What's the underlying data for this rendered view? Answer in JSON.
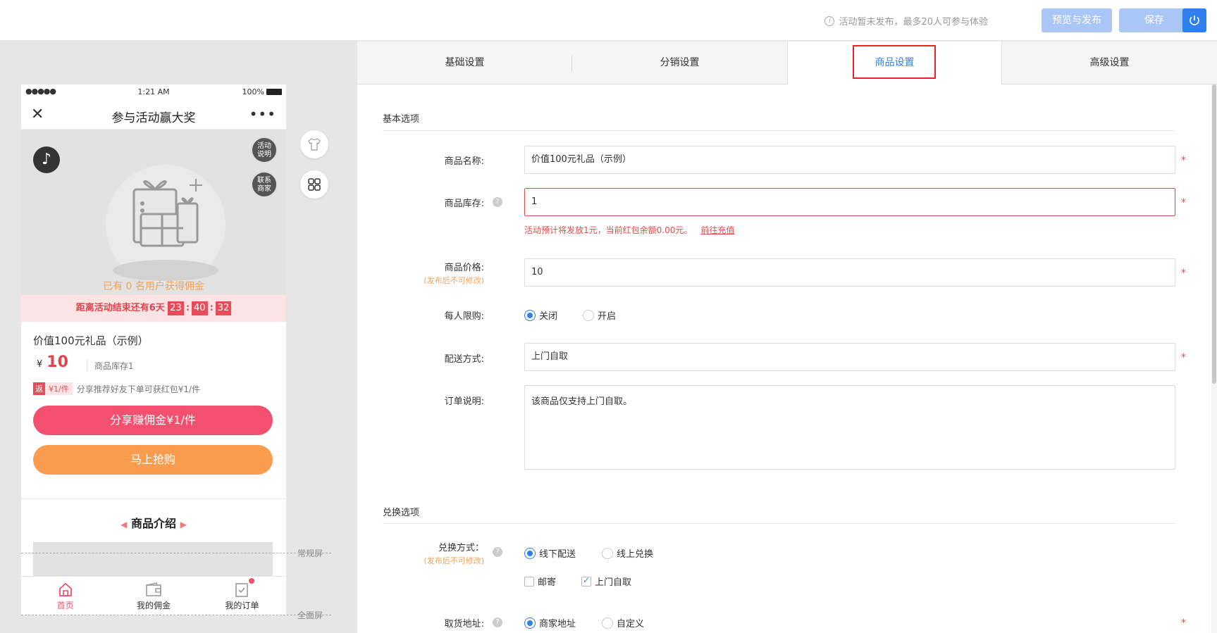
{
  "topbar": {
    "note": "活动暂未发布，最多20人可参与体验",
    "preview_label": "预览与发布",
    "save_label": "保存"
  },
  "phone": {
    "status": {
      "signal": "●●●●●",
      "time": "1:21 AM",
      "battery": "100%"
    },
    "nav_title": "参与活动赢大奖",
    "badge_rules": "活动\n说明",
    "badge_contact": "联系\n商家",
    "banner_text": "已有 0 名用户获得佣金",
    "countdown": {
      "label": "距离活动结束还有6天",
      "h": "23",
      "m": "40",
      "s": "32"
    },
    "product": {
      "name": "价值100元礼品（示例）",
      "currency": "¥",
      "price": "10",
      "stock": "商品库存1",
      "rebate_tag": "返",
      "rebate_amount": "¥1/件",
      "rebate_text": "分享推荐好友下单可获红包¥1/件"
    },
    "share_button": "分享赚佣金¥1/件",
    "buy_button": "马上抢购",
    "intro_title": "商品介绍",
    "tabs": [
      {
        "label": "首页"
      },
      {
        "label": "我的佣金"
      },
      {
        "label": "我的订单"
      }
    ]
  },
  "guides": {
    "normal": "常规屏",
    "full": "全面屏"
  },
  "tabs": [
    {
      "label": "基础设置"
    },
    {
      "label": "分销设置"
    },
    {
      "label": "商品设置"
    },
    {
      "label": "高级设置"
    }
  ],
  "form": {
    "basic_section": "基本选项",
    "name_label": "商品名称:",
    "name_value": "价值100元礼品（示例）",
    "stock_label": "商品库存:",
    "stock_value": "1",
    "stock_error": "活动预计将发放1元，当前红包余额0.00元。",
    "stock_error_link": "前往充值",
    "price_label": "商品价格:",
    "price_note": "(发布后不可修改)",
    "price_value": "10",
    "limit_label": "每人限购:",
    "limit_off": "关闭",
    "limit_on": "开启",
    "delivery_label": "配送方式:",
    "delivery_value": "上门自取",
    "order_note_label": "订单说明:",
    "order_note_value": "该商品仅支持上门自取。",
    "redeem_section": "兑换选项",
    "redeem_label": "兑换方式：",
    "redeem_note": "(发布后不可修改)",
    "redeem_offline": "线下配送",
    "redeem_online": "线上兑换",
    "opt_mail": "邮寄",
    "opt_pickup": "上门自取",
    "pickup_label": "取货地址:",
    "pickup_merchant": "商家地址",
    "pickup_custom": "自定义",
    "required_mark": "*",
    "help_mark": "?"
  },
  "colors": {
    "primary": "#2f80ed",
    "danger": "#e34b4b",
    "pink": "#f2506e",
    "orange": "#fa9c4e",
    "btn_disabled": "#a9c6f7"
  }
}
